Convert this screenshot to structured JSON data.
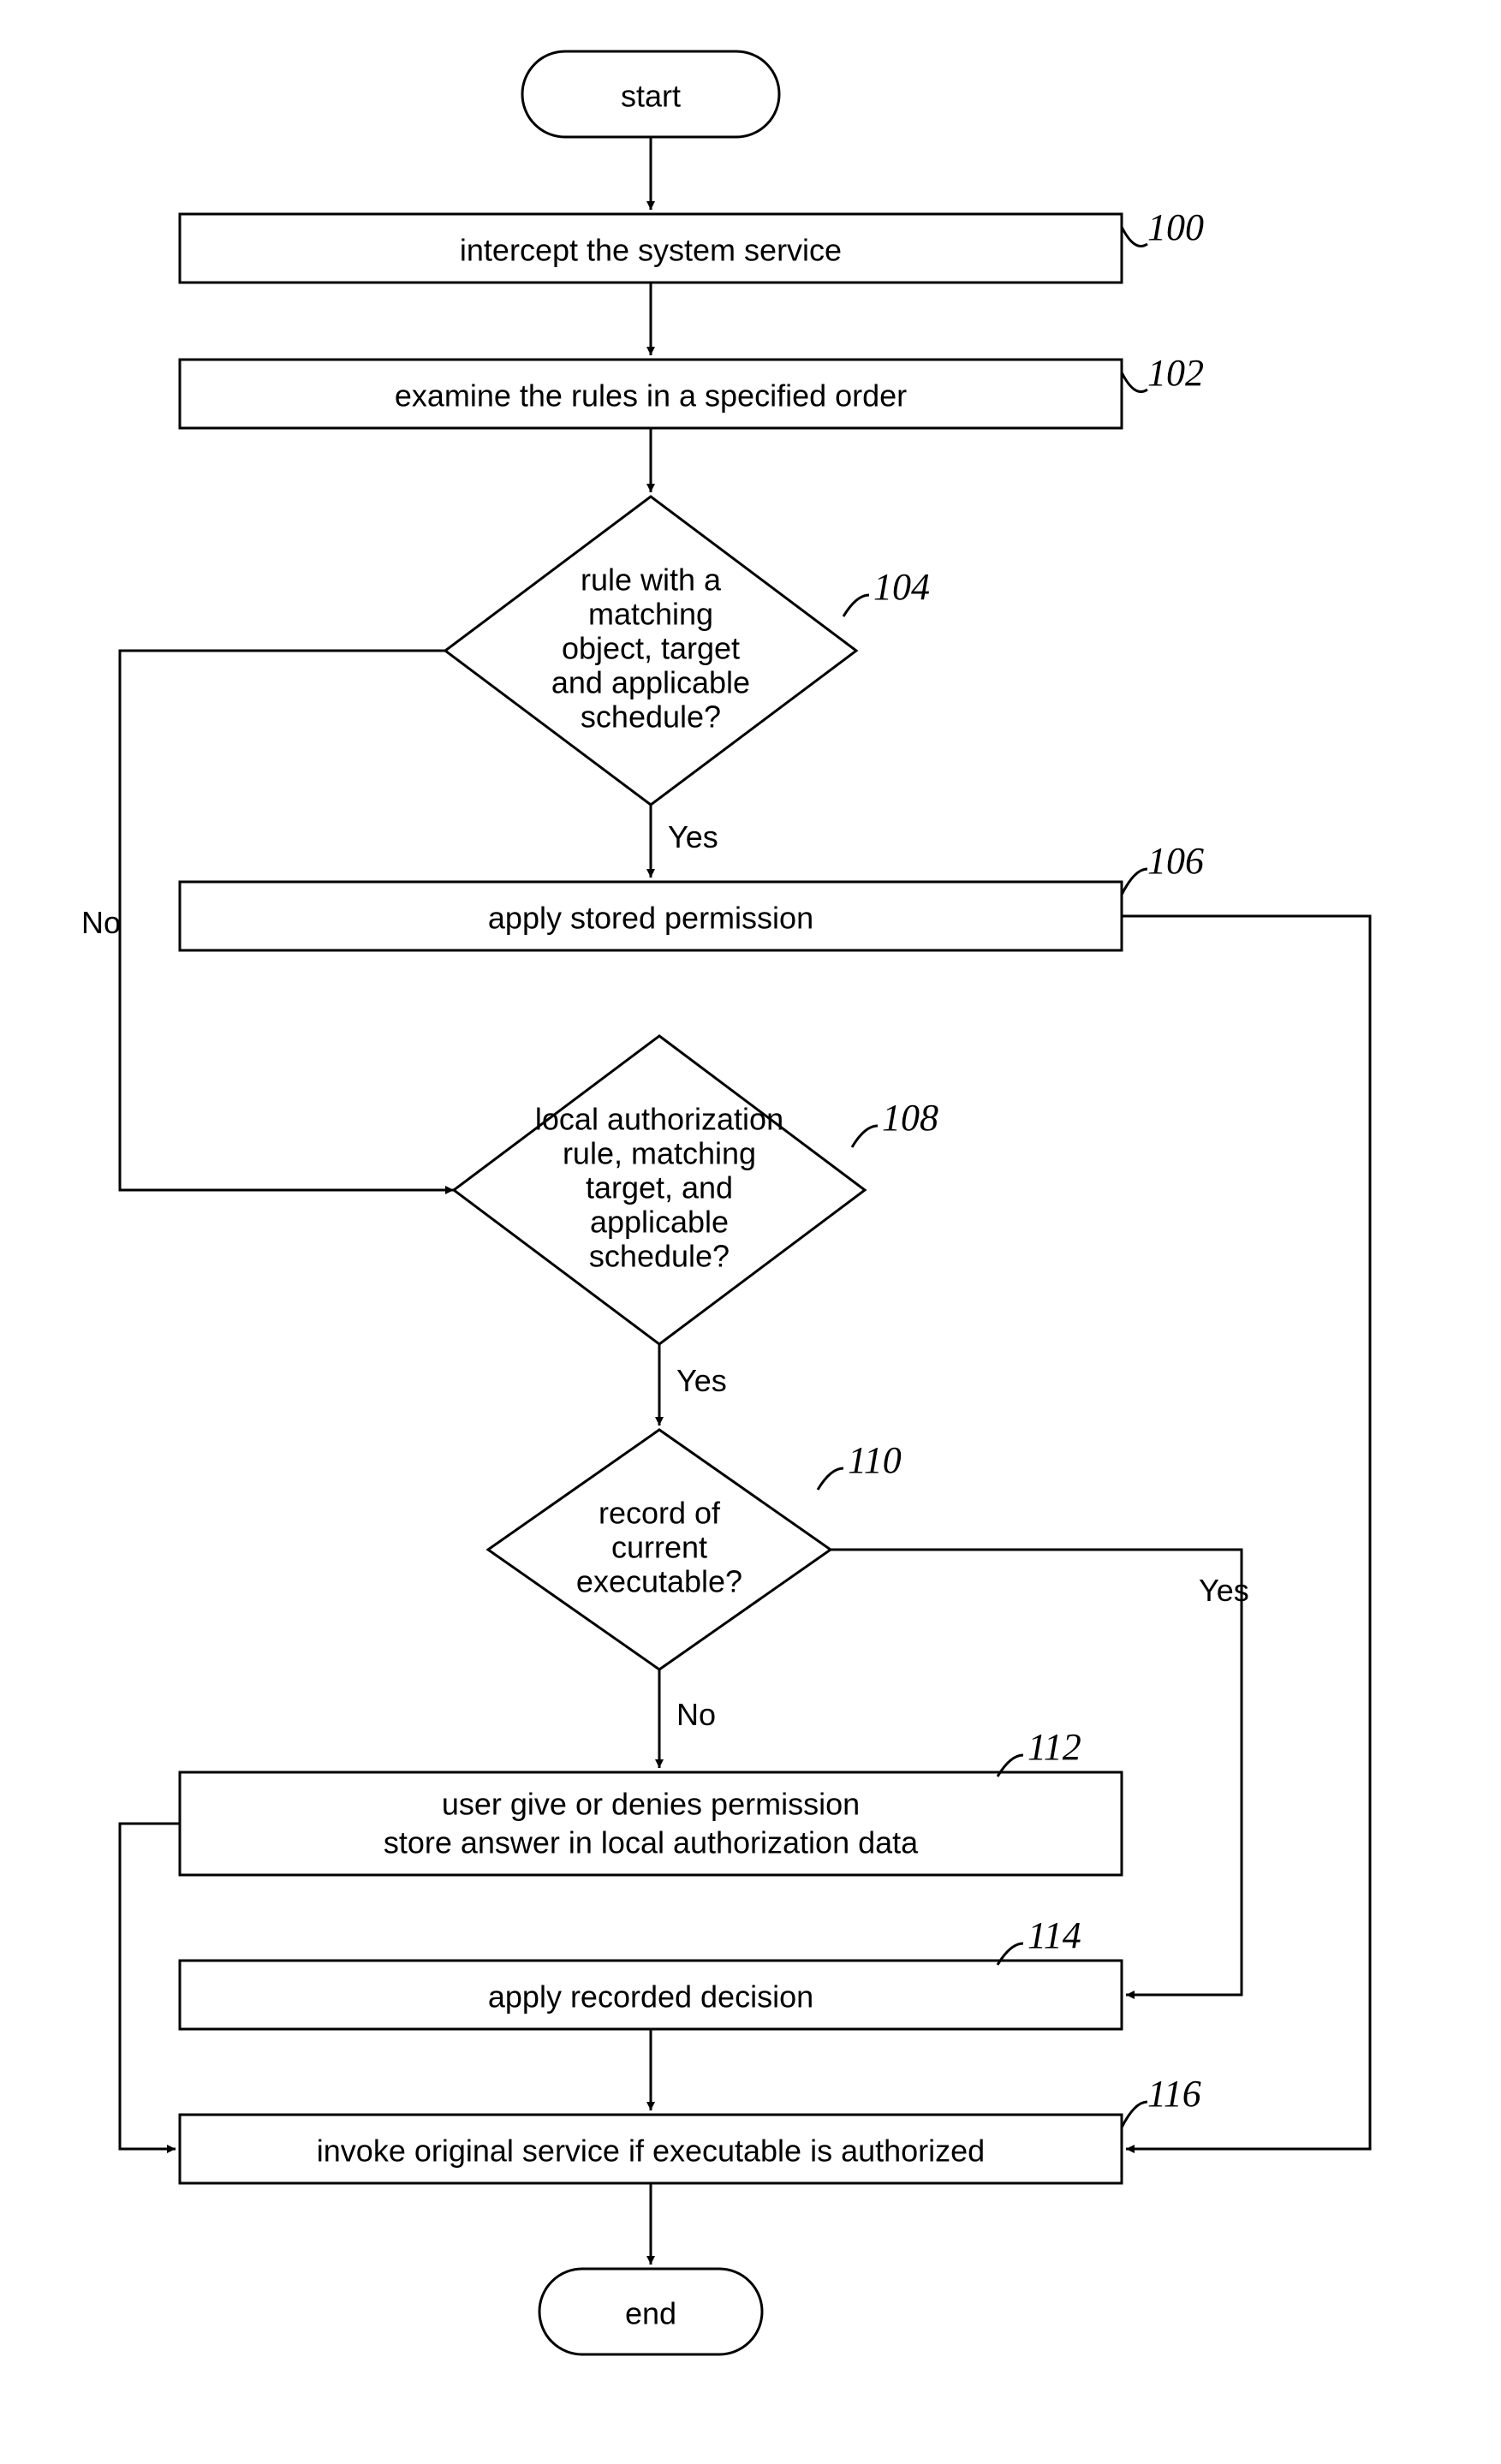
{
  "nodes": {
    "start": "start",
    "s100": "intercept the system service",
    "s102": "examine the rules in a specified order",
    "d104_l1": "rule with a",
    "d104_l2": "matching",
    "d104_l3": "object, target",
    "d104_l4": "and applicable",
    "d104_l5": "schedule?",
    "s106": "apply stored permission",
    "d108_l1": "local authorization",
    "d108_l2": "rule, matching",
    "d108_l3": "target, and",
    "d108_l4": "applicable",
    "d108_l5": "schedule?",
    "d110_l1": "record of",
    "d110_l2": "current",
    "d110_l3": "executable?",
    "s112_l1": "user give or denies permission",
    "s112_l2": "store answer in local authorization data",
    "s114": "apply recorded decision",
    "s116": "invoke original service if executable is authorized",
    "end": "end"
  },
  "edges": {
    "yes": "Yes",
    "no": "No"
  },
  "refs": {
    "r100": "100",
    "r102": "102",
    "r104": "104",
    "r106": "106",
    "r108": "108",
    "r110": "110",
    "r112": "112",
    "r114": "114",
    "r116": "116"
  }
}
